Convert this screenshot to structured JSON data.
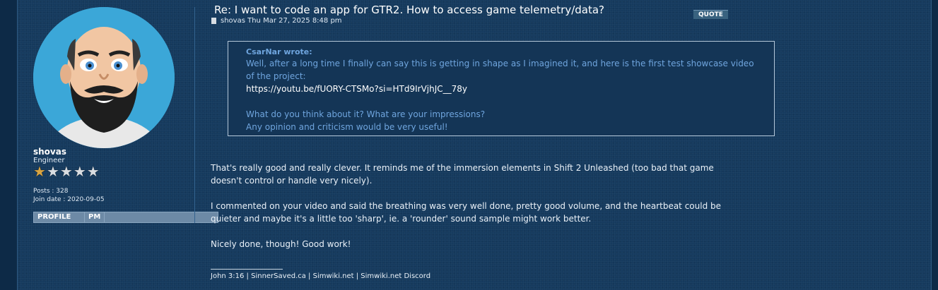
{
  "post": {
    "title": "Re: I want to code an app for GTR2. How to access game telemetry/data?",
    "quote_button": "QUOTE",
    "meta": "shovas Thu Mar 27, 2025 8:48 pm",
    "author": {
      "username": "shovas",
      "rank": "Engineer",
      "rating_stars": 1,
      "rating_max": 5,
      "posts": "Posts : 328",
      "join_date": "Join date : 2020-09-05",
      "profile_button": "PROFILE",
      "pm_button": "PM",
      "avatar_icon": "bald-bearded-man-cartoon-avatar"
    },
    "quote": {
      "author": "CsarNar wrote:",
      "lines": [
        "Well, after a long time I finally can say this is getting in shape as I imagined it, and here is the first test showcase video",
        "of the project:",
        "https://youtu.be/fUORY-CTSMo?si=HTd9IrVjhJC__78y",
        "",
        "What do you think about it? What are your impressions?",
        "Any opinion and criticism would be very useful!"
      ]
    },
    "body": [
      "That's really good and really clever. It reminds me of the immersion elements in Shift 2 Unleashed (too bad that game",
      "doesn't control or handle very nicely).",
      "",
      "I commented on your video and said the breathing was very well done, pretty good volume, and the heartbeat could be",
      "quieter and maybe it's a little too 'sharp', ie. a 'rounder' sound sample might work better.",
      "",
      "Nicely done, though! Good work!"
    ],
    "signature": "John 3:16 | SinnerSaved.ca | Simwiki.net | Simwiki.net Discord"
  },
  "colors": {
    "background": "#153a5e",
    "quote_text": "#6fa5de",
    "button": "#6d8aa6",
    "avatar_bg": "#3ba7d8"
  }
}
